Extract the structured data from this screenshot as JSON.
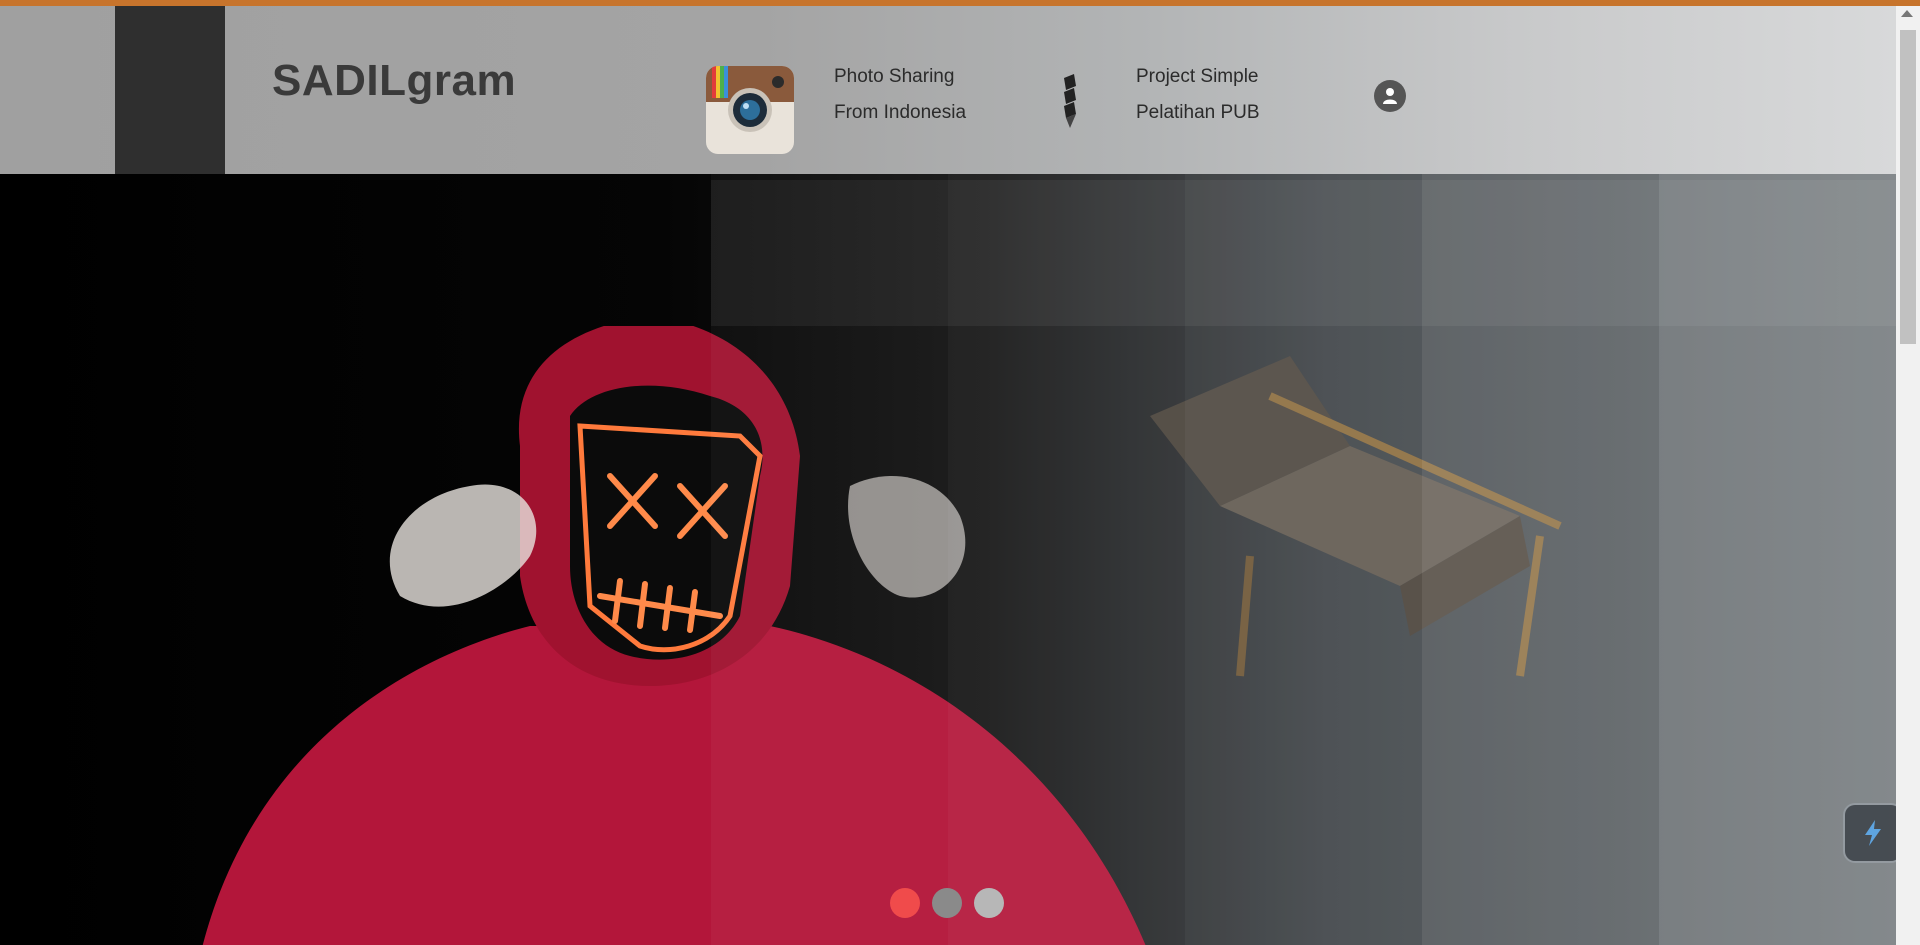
{
  "header": {
    "brand": "SADILgram",
    "tagline_line1": "Photo Sharing",
    "tagline_line2": "From Indonesia",
    "project_line1": "Project Simple",
    "project_line2": "Pelatihan PUB",
    "icons": [
      "camera-logo-icon",
      "pen-icon",
      "user-icon"
    ]
  },
  "carousel": {
    "slide_count": 3,
    "active_index": 0,
    "colors": {
      "active": "#f04b4b",
      "inactive": "#8a8a8a",
      "inactive_light": "#b7b7b7"
    }
  },
  "theme": {
    "accent_top_bar": "#c7742c",
    "header_dark_block": "#2f2f2f",
    "brand_text": "#3a3a3a",
    "hoodie_red": "#c0183a",
    "neon_orange": "#ff7a3c"
  },
  "floating_button": {
    "icon": "lightning-icon"
  }
}
